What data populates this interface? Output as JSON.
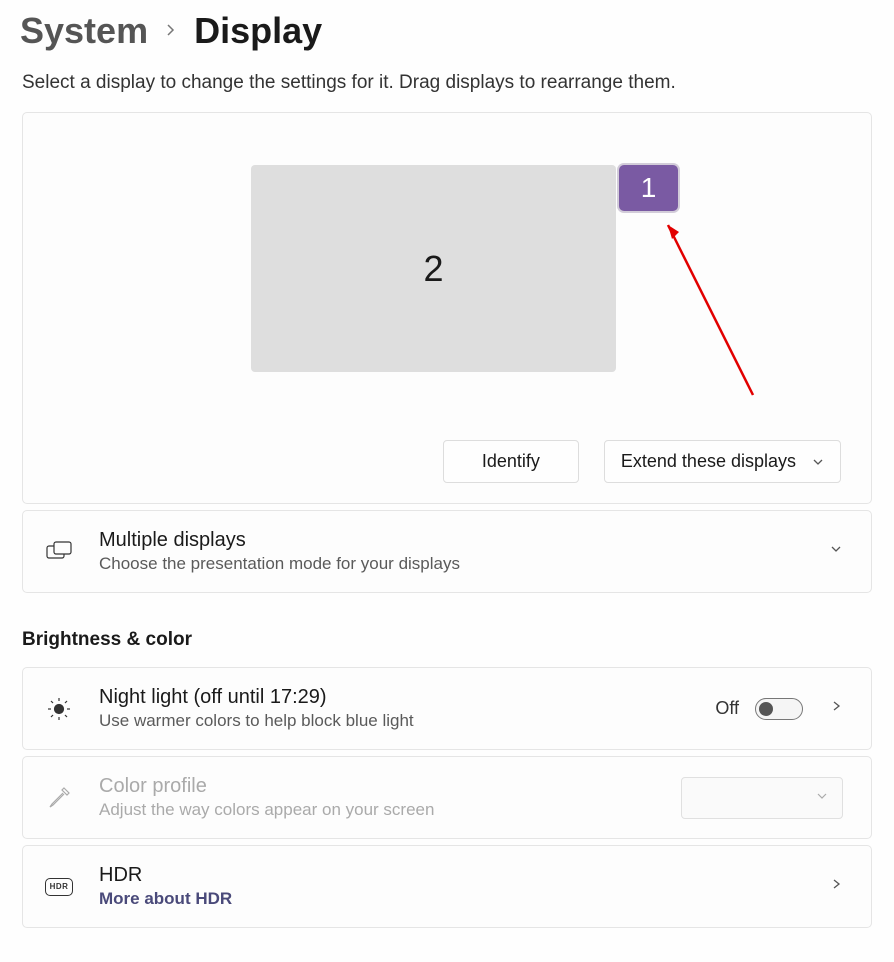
{
  "breadcrumb": {
    "parent": "System",
    "current": "Display"
  },
  "subtitle": "Select a display to change the settings for it. Drag displays to rearrange them.",
  "arrangement": {
    "display1_label": "1",
    "display2_label": "2",
    "identify_button": "Identify",
    "mode_select": "Extend these displays"
  },
  "multiple_displays": {
    "title": "Multiple displays",
    "subtitle": "Choose the presentation mode for your displays"
  },
  "section_brightness": "Brightness & color",
  "night_light": {
    "title": "Night light (off until 17:29)",
    "subtitle": "Use warmer colors to help block blue light",
    "toggle_label": "Off"
  },
  "color_profile": {
    "title": "Color profile",
    "subtitle": "Adjust the way colors appear on your screen",
    "value": ""
  },
  "hdr": {
    "title": "HDR",
    "link": "More about HDR",
    "badge": "HDR"
  }
}
